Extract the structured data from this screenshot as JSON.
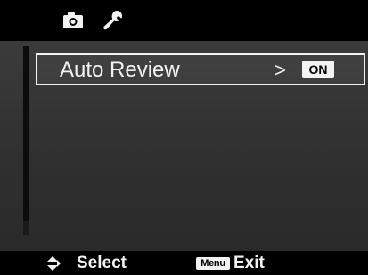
{
  "tabs": [
    {
      "icon": "camera-icon",
      "active": true
    },
    {
      "icon": "wrench-icon",
      "active": false
    }
  ],
  "menu": {
    "items": [
      {
        "label": "Auto Review",
        "arrow": ">",
        "value": "ON",
        "selected": true
      }
    ]
  },
  "footer": {
    "nav_icon": "up-down-arrows-icon",
    "select_label": "Select",
    "menu_key_label": "Menu",
    "exit_label": "Exit"
  },
  "colors": {
    "background": "#000000",
    "menu_background": "#333333",
    "foreground": "#f2f2f2"
  }
}
